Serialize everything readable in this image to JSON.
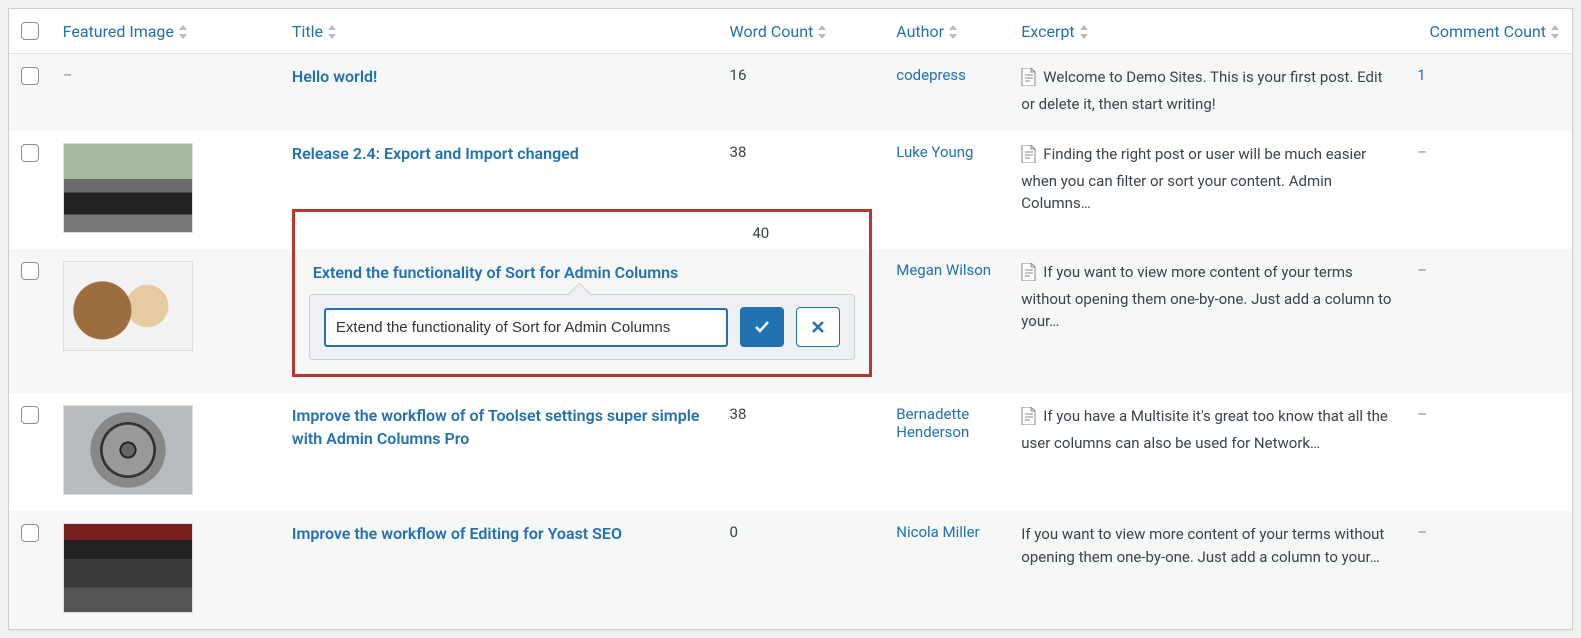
{
  "columns": {
    "featured_image": "Featured Image",
    "title": "Title",
    "word_count": "Word Count",
    "author": "Author",
    "excerpt": "Excerpt",
    "comment_count": "Comment Count"
  },
  "rows": [
    {
      "thumb": "none",
      "title": "Hello world!",
      "word_count": "16",
      "author": "codepress",
      "excerpt": "Welcome to Demo Sites. This is your first post. Edit or delete it, then start writing!",
      "has_icon": true,
      "comment_count": "1",
      "comment_is_link": true
    },
    {
      "thumb": "car",
      "title": "Release 2.4: Export and Import changed",
      "word_count": "38",
      "author": "Luke Young",
      "excerpt": "Finding the right post or user will be much easier when you can filter or sort your content. Admin Columns…",
      "has_icon": true,
      "comment_count": "–",
      "comment_is_link": false
    },
    {
      "thumb": "shoe",
      "title": "Extend the functionality of Sort for Admin Columns",
      "word_count": "40",
      "author": "Megan Wilson",
      "excerpt": "If you want to view more content of your terms without opening them one-by-one. Just add a column to your…",
      "has_icon": true,
      "comment_count": "–",
      "comment_is_link": false,
      "editing": true
    },
    {
      "thumb": "wheel",
      "title": "Improve the workflow of of Toolset settings super simple with Admin Columns Pro",
      "word_count": "38",
      "author": "Bernadette Henderson",
      "excerpt": "If you have a Multisite it's great too know that all the user columns can also be used for Network…",
      "has_icon": true,
      "comment_count": "–",
      "comment_is_link": false
    },
    {
      "thumb": "seats",
      "title": "Improve the workflow of Editing for Yoast SEO",
      "word_count": "0",
      "author": "Nicola Miller",
      "excerpt": "If you want to view more content of your terms without opening them one-by-one. Just add a column to your…",
      "has_icon": false,
      "comment_count": "–",
      "comment_is_link": false
    }
  ],
  "edit": {
    "value": "Extend the functionality of Sort for Admin Columns"
  }
}
